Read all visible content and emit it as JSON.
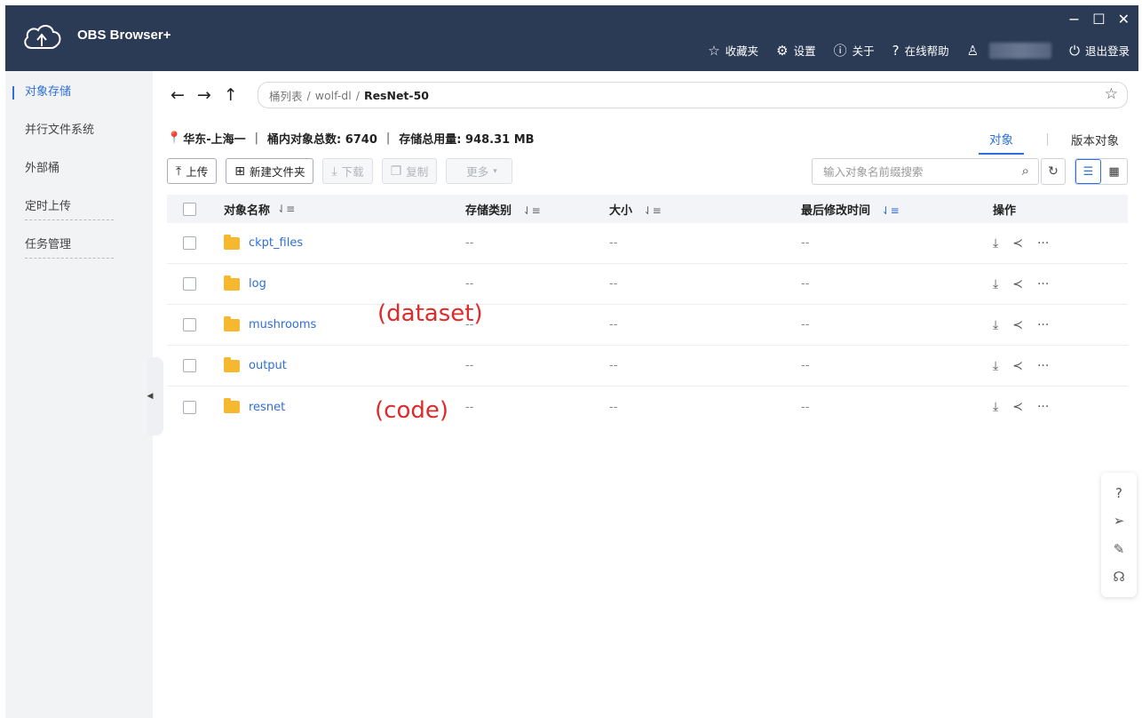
{
  "app": {
    "name": "OBS Browser+",
    "window_controls": {
      "minimize": "−",
      "maximize": "☐",
      "close": "✕"
    }
  },
  "top_menu": {
    "favorites": "收藏夹",
    "settings": "设置",
    "about": "关于",
    "help": "在线帮助",
    "logout": "退出登录"
  },
  "sidebar": {
    "items": [
      {
        "label": "对象存储",
        "active": true
      },
      {
        "label": "并行文件系统",
        "active": false
      },
      {
        "label": "外部桶",
        "active": false
      },
      {
        "label": "定时上传",
        "active": false
      },
      {
        "label": "任务管理",
        "active": false
      }
    ]
  },
  "breadcrumb": {
    "root": "桶列表",
    "bucket": "wolf-dl",
    "current": "ResNet-50",
    "separator": "/"
  },
  "info": {
    "region": "华东-上海一",
    "object_count": "桶内对象总数: 6740",
    "storage_used": "存储总用量: 948.31 MB",
    "divider": "|"
  },
  "view_tabs": {
    "objects": "对象",
    "versions": "版本对象"
  },
  "toolbar": {
    "upload": "上传",
    "new_folder": "新建文件夹",
    "download": "下载",
    "copy": "复制",
    "more": "更多"
  },
  "search": {
    "placeholder": "输入对象名前缀搜索",
    "value": ""
  },
  "table": {
    "headers": {
      "name": "对象名称",
      "storage_class": "存储类别",
      "size": "大小",
      "modified": "最后修改时间",
      "ops": "操作"
    },
    "rows": [
      {
        "name": "ckpt_files",
        "storage_class": "--",
        "size": "--",
        "modified": "--"
      },
      {
        "name": "log",
        "storage_class": "--",
        "size": "--",
        "modified": "--"
      },
      {
        "name": "mushrooms",
        "storage_class": "--",
        "size": "--",
        "modified": "--"
      },
      {
        "name": "output",
        "storage_class": "--",
        "size": "--",
        "modified": "--"
      },
      {
        "name": "resnet",
        "storage_class": "--",
        "size": "--",
        "modified": "--"
      }
    ]
  },
  "annotations": {
    "dataset": "(dataset)",
    "code": "(code)"
  },
  "colors": {
    "titlebar": "#2b3a55",
    "accent": "#2e6fdb",
    "folder": "#f5b82e",
    "annotation": "#e02a2a"
  }
}
